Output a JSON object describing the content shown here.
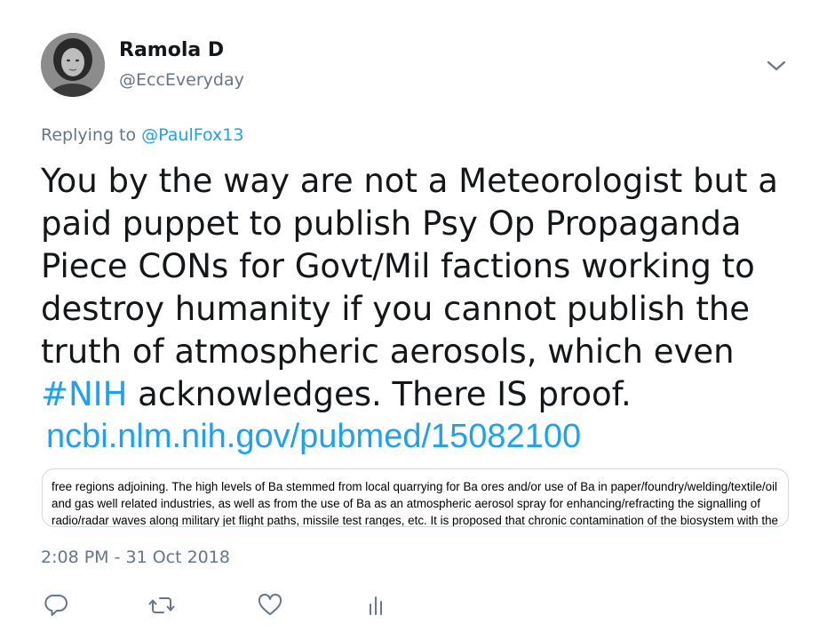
{
  "author": {
    "name": "Ramola D",
    "handle": "@EccEveryday",
    "avatar_icon": "user-photo"
  },
  "reply": {
    "prefix": "Replying to ",
    "mention": "@PaulFox13"
  },
  "tweet": {
    "lines": [
      "You by the way are not a Meteorologist but a",
      "paid puppet to publish Psy Op Propaganda",
      "Piece CONs for Govt/Mil factions working to",
      "destroy humanity if you cannot publish the",
      "truth of atmospheric aerosols, which even"
    ],
    "hashtag": "#NIH",
    "last_line_rest": " acknowledges. There IS proof.",
    "link": "ncbi.nlm.nih.gov/pubmed/15082100"
  },
  "card": {
    "lines": [
      "free regions adjoining. The high levels of Ba stemmed from local quarrying for Ba ores and/or use of Ba in paper/foundry/welding/textile/oil",
      "and gas well related industries, as well as from the use of Ba as an atmospheric aerosol spray for enhancing/refracting the signalling of",
      "radio/radar waves along military jet flight paths, missile test ranges, etc. It is proposed that chronic contamination of the biosystem with the"
    ]
  },
  "timestamp": "2:08 PM - 31 Oct 2018",
  "actions": {
    "reply_icon": "reply-icon",
    "retweet_icon": "retweet-icon",
    "like_icon": "heart-icon",
    "analytics_icon": "analytics-icon"
  },
  "colors": {
    "link": "#1da1f2",
    "secondary_text": "#657786",
    "primary_text": "#14171a",
    "border": "#cfd9de"
  }
}
